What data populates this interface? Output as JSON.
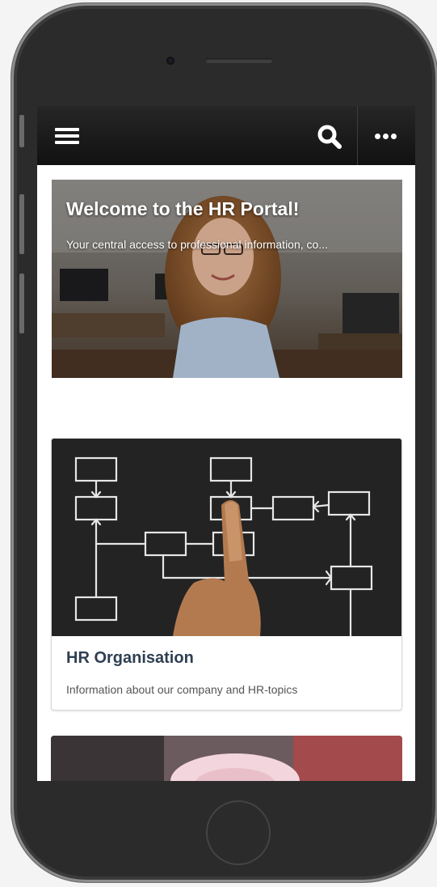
{
  "topbar": {
    "menu_icon": "hamburger-menu-icon",
    "search_icon": "search-icon",
    "more_icon": "more-horizontal-icon"
  },
  "hero": {
    "title": "Welcome to the HR Portal!",
    "subtitle": "Your central access to professional information, co..."
  },
  "cards": [
    {
      "title": "HR Organisation",
      "description": "Information about our company and HR-topics",
      "image": "flowchart-chalkboard-image"
    },
    {
      "image": "piggy-bank-image"
    }
  ]
}
